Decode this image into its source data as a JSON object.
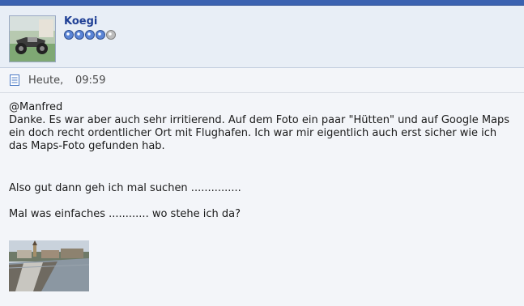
{
  "user": {
    "name": "Koegi",
    "rank": {
      "filled": 4,
      "total": 5
    }
  },
  "post": {
    "date": "Heute,",
    "time": "09:59",
    "mention": "@Manfred",
    "paragraph1_lines": [
      "Danke. Es war aber auch sehr irritierend. Auf dem Foto ein paar \"Hütten\" und auf Google Maps",
      "ein doch recht ordentlicher Ort mit Flughafen. Ich war mir eigentlich auch erst sicher wie ich",
      "das Maps-Foto gefunden hab."
    ],
    "paragraph2": "Also gut dann geh ich mal suchen ...............",
    "paragraph3": "Mal was einfaches ............ wo stehe ich da?"
  },
  "colors": {
    "topbar": "#3b62b0",
    "username": "#1f3f95",
    "background": "#f3f5f9"
  },
  "icons": {
    "post": "document-icon",
    "rank": "rank-dot-icon"
  }
}
